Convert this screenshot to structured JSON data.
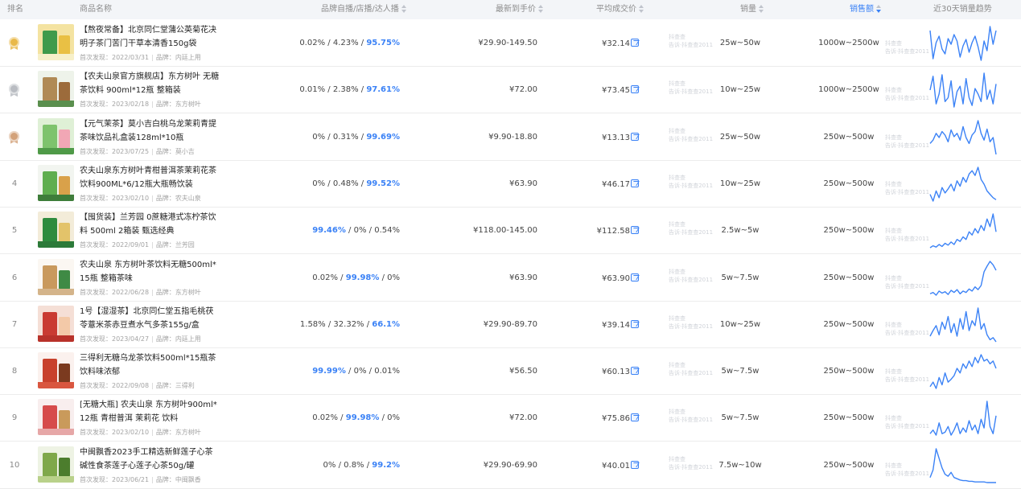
{
  "colors": {
    "accent": "#3b82f6",
    "header_bg": "#f3f5f8",
    "gold": "#e9b949",
    "silver": "#b9bcc2",
    "bronze": "#d3a27a"
  },
  "header": {
    "rank": "排名",
    "product": "商品名称",
    "ratio": "品牌自播/店播/达人播",
    "price": "最新到手价",
    "avg_price": "平均成交价",
    "volume": "销量",
    "gmv": "销售额",
    "trend": "近30天销量趋势"
  },
  "meta_labels": {
    "first_seen": "首次发现：",
    "brand": "品牌："
  },
  "watermark": {
    "line1": "抖查查",
    "line2": "告诉·抖查查2011"
  },
  "rows": [
    {
      "rank": "1",
      "medal": "gold",
      "name": "【熬夜常备】北京同仁堂蒲公英菊花决明子茶门苦门干草本清香150g袋",
      "first_seen": "2022/03/31",
      "brand": "内廷上用",
      "ratio": {
        "a": "0.02%",
        "b": "4.23%",
        "c": "95.75%",
        "hl": "c"
      },
      "price": "¥29.90-149.50",
      "avg_price": "¥32.14",
      "volume": "25w~50w",
      "gmv": "1000w~2500w",
      "trend": [
        55,
        20,
        40,
        48,
        32,
        26,
        45,
        38,
        50,
        42,
        22,
        36,
        44,
        28,
        40,
        48,
        35,
        18,
        42,
        30,
        60,
        38,
        55
      ],
      "thumb": [
        "#f4e3a1",
        "#3f9a4b",
        "#e9c044",
        "#f7f0c9"
      ]
    },
    {
      "rank": "2",
      "medal": "silver",
      "name": "【农夫山泉官方旗舰店】东方树叶 无糖 茶饮料 900ml*12瓶 整箱装",
      "first_seen": "2023/02/18",
      "brand": "东方树叶",
      "ratio": {
        "a": "0.01%",
        "b": "2.38%",
        "c": "97.61%",
        "hl": "c"
      },
      "price": "¥72.00",
      "avg_price": "¥73.45",
      "volume": "10w~25w",
      "gmv": "1000w~2500w",
      "trend": [
        40,
        58,
        22,
        35,
        60,
        25,
        30,
        52,
        18,
        38,
        45,
        22,
        55,
        30,
        20,
        42,
        35,
        25,
        62,
        28,
        40,
        22,
        48
      ],
      "thumb": [
        "#eef3ea",
        "#b08a55",
        "#9c6b3b",
        "#5a8f4e"
      ]
    },
    {
      "rank": "3",
      "medal": "bronze",
      "name": "【元气茉茶】莫小吉白桃乌龙茉莉青提茶味饮品礼盒装128ml*10瓶",
      "first_seen": "2023/07/25",
      "brand": "莫小吉",
      "ratio": {
        "a": "0%",
        "b": "0.31%",
        "c": "99.69%",
        "hl": "c"
      },
      "price": "¥9.90-18.80",
      "avg_price": "¥13.13",
      "volume": "25w~50w",
      "gmv": "250w~500w",
      "trend": [
        28,
        32,
        40,
        35,
        42,
        38,
        30,
        44,
        36,
        40,
        32,
        48,
        35,
        28,
        38,
        42,
        55,
        40,
        32,
        45,
        30,
        35,
        15
      ],
      "thumb": [
        "#dff0d6",
        "#7ec36d",
        "#f1a7b5",
        "#4f9a48"
      ]
    },
    {
      "rank": "4",
      "medal": "",
      "name": "农夫山泉东方树叶青柑普洱茶茉莉花茶饮料900ML*6/12瓶大瓶畅饮装",
      "first_seen": "2023/02/10",
      "brand": "农夫山泉",
      "ratio": {
        "a": "0%",
        "b": "0.48%",
        "c": "99.52%",
        "hl": "c"
      },
      "price": "¥63.90",
      "avg_price": "¥46.17",
      "volume": "10w~25w",
      "gmv": "250w~500w",
      "trend": [
        20,
        10,
        25,
        15,
        30,
        22,
        28,
        35,
        25,
        40,
        32,
        45,
        38,
        50,
        55,
        48,
        60,
        42,
        35,
        25,
        20,
        15,
        12
      ],
      "thumb": [
        "#f2f5f0",
        "#5fae4f",
        "#d9a14a",
        "#3e7d3a"
      ]
    },
    {
      "rank": "5",
      "medal": "",
      "name": "【囤货装】兰芳园 0蔗糖港式冻柠茶饮料 500ml 2箱装 甄选经典",
      "first_seen": "2022/09/01",
      "brand": "兰芳园",
      "ratio": {
        "a": "99.46%",
        "b": "0%",
        "c": "0.54%",
        "hl": "a"
      },
      "price": "¥118.00-145.00",
      "avg_price": "¥112.58",
      "volume": "2.5w~5w",
      "gmv": "250w~500w",
      "trend": [
        5,
        8,
        6,
        10,
        7,
        12,
        9,
        14,
        10,
        18,
        15,
        22,
        18,
        30,
        25,
        35,
        28,
        40,
        32,
        50,
        38,
        58,
        30
      ],
      "thumb": [
        "#f3ecd9",
        "#2e8b3e",
        "#e3c36a",
        "#2c7a39"
      ]
    },
    {
      "rank": "6",
      "medal": "",
      "name": "农夫山泉 东方树叶茶饮料无糖500ml*15瓶 整箱茶味",
      "first_seen": "2022/06/28",
      "brand": "东方树叶",
      "ratio": {
        "a": "0.02%",
        "b": "99.98%",
        "c": "0%",
        "hl": "b"
      },
      "price": "¥63.90",
      "avg_price": "¥63.90",
      "volume": "5w~7.5w",
      "gmv": "250w~500w",
      "trend": [
        8,
        10,
        6,
        12,
        9,
        11,
        7,
        13,
        10,
        14,
        8,
        12,
        10,
        15,
        12,
        18,
        14,
        20,
        40,
        48,
        55,
        50,
        42
      ],
      "thumb": [
        "#fbf7f2",
        "#c9995d",
        "#3f8a45",
        "#d4b48a"
      ]
    },
    {
      "rank": "7",
      "medal": "",
      "name": "1号【湿湿茶】北京同仁堂五指毛桃茯苓薏米茶赤豆煮水气多茶155g/盒",
      "first_seen": "2023/04/27",
      "brand": "内廷上用",
      "ratio": {
        "a": "1.58%",
        "b": "32.32%",
        "c": "66.1%",
        "hl": "c"
      },
      "price": "¥29.90-89.70",
      "avg_price": "¥39.14",
      "volume": "10w~25w",
      "gmv": "250w~500w",
      "trend": [
        20,
        28,
        35,
        22,
        40,
        30,
        48,
        25,
        38,
        20,
        45,
        30,
        55,
        28,
        42,
        35,
        60,
        30,
        38,
        22,
        15,
        18,
        12
      ],
      "thumb": [
        "#f5dfd6",
        "#c93b32",
        "#f3c9a8",
        "#b8322a"
      ]
    },
    {
      "rank": "8",
      "medal": "",
      "name": "三得利无糖乌龙茶饮料500ml*15瓶茶饮料味浓郁",
      "first_seen": "2022/09/08",
      "brand": "三得利",
      "ratio": {
        "a": "99.99%",
        "b": "0%",
        "c": "0.01%",
        "hl": "a"
      },
      "price": "¥56.50",
      "avg_price": "¥60.13",
      "volume": "5w~7.5w",
      "gmv": "250w~500w",
      "trend": [
        10,
        15,
        8,
        20,
        12,
        25,
        15,
        18,
        22,
        30,
        25,
        35,
        30,
        38,
        32,
        42,
        36,
        45,
        38,
        40,
        35,
        38,
        30
      ],
      "thumb": [
        "#fbf1ee",
        "#c8412d",
        "#7b3a1f",
        "#d9563f"
      ]
    },
    {
      "rank": "9",
      "medal": "",
      "name": "[无糖大瓶] 农夫山泉 东方树叶900ml*12瓶 青柑普洱 茉莉花 饮料",
      "first_seen": "2023/02/10",
      "brand": "东方树叶",
      "ratio": {
        "a": "0.02%",
        "b": "99.98%",
        "c": "0%",
        "hl": "b"
      },
      "price": "¥72.00",
      "avg_price": "¥75.86",
      "volume": "5w~7.5w",
      "gmv": "250w~500w",
      "trend": [
        10,
        15,
        8,
        25,
        10,
        12,
        20,
        8,
        15,
        25,
        10,
        18,
        12,
        28,
        15,
        22,
        10,
        30,
        18,
        55,
        20,
        10,
        35
      ],
      "thumb": [
        "#f8eeee",
        "#d64b4b",
        "#c99a5b",
        "#e6a7a7"
      ]
    },
    {
      "rank": "10",
      "medal": "",
      "name": "中闽飘香2023手工精选新鲜莲子心茶碱性食茶莲子心莲子心茶50g/罐",
      "first_seen": "2023/06/21",
      "brand": "中闽飘香",
      "ratio": {
        "a": "0%",
        "b": "0.8%",
        "c": "99.2%",
        "hl": "c"
      },
      "price": "¥29.90-69.90",
      "avg_price": "¥40.01",
      "volume": "7.5w~10w",
      "gmv": "250w~500w",
      "trend": [
        10,
        22,
        55,
        40,
        25,
        15,
        12,
        18,
        10,
        8,
        6,
        5,
        5,
        4,
        4,
        3,
        3,
        3,
        3,
        2,
        2,
        2,
        2
      ],
      "thumb": [
        "#eef3e4",
        "#7fa84a",
        "#4c7d2d",
        "#b9d18a"
      ]
    }
  ]
}
